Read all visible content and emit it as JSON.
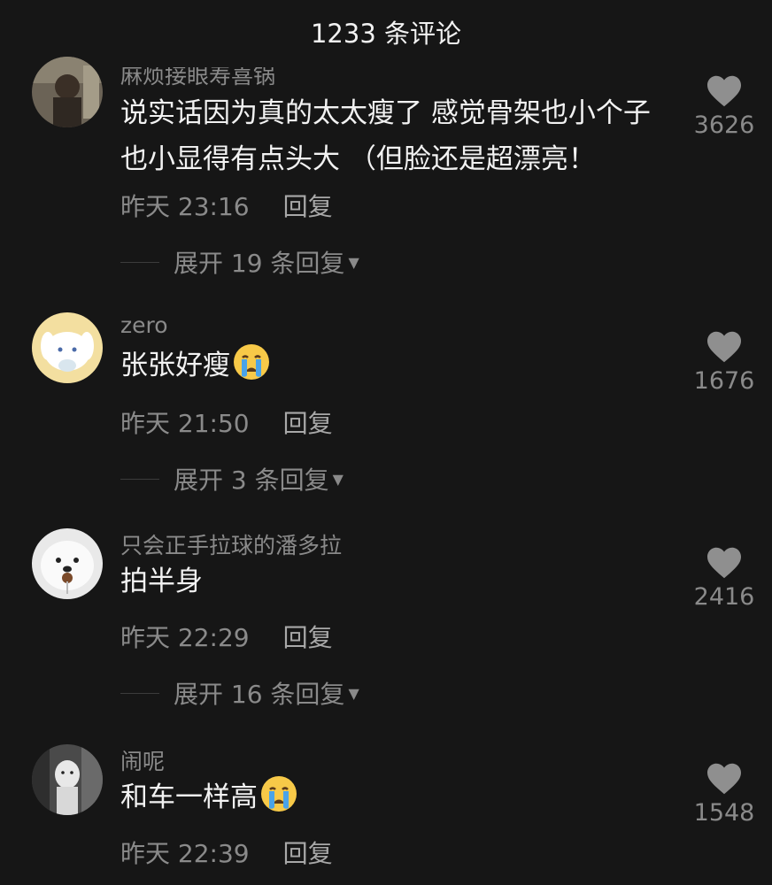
{
  "header": {
    "title": "1233 条评论"
  },
  "comments": [
    {
      "username": "麻烦接眼寿喜锅",
      "text": "说实话因为真的太太瘦了 感觉骨架也小个子也小显得有点头大 （但脸还是超漂亮！",
      "time": "昨天 23:16",
      "reply": "回复",
      "expand": "展开 19 条回复",
      "likes": "3626"
    },
    {
      "username": "zero",
      "text": "张张好瘦",
      "emoji": "crying-face",
      "time": "昨天 21:50",
      "reply": "回复",
      "expand": "展开 3 条回复",
      "likes": "1676"
    },
    {
      "username": "只会正手拉球的潘多拉",
      "text": "拍半身",
      "time": "昨天 22:29",
      "reply": "回复",
      "expand": "展开 16 条回复",
      "likes": "2416"
    },
    {
      "username": "闹呢",
      "text": "和车一样高",
      "emoji": "crying-face",
      "time": "昨天 22:39",
      "reply": "回复",
      "likes": "1548"
    }
  ],
  "colors": {
    "background": "#161616",
    "secondary_text": "#8a8a8a",
    "primary_text": "#f2f2f2",
    "heart": "#8f8f8f"
  }
}
